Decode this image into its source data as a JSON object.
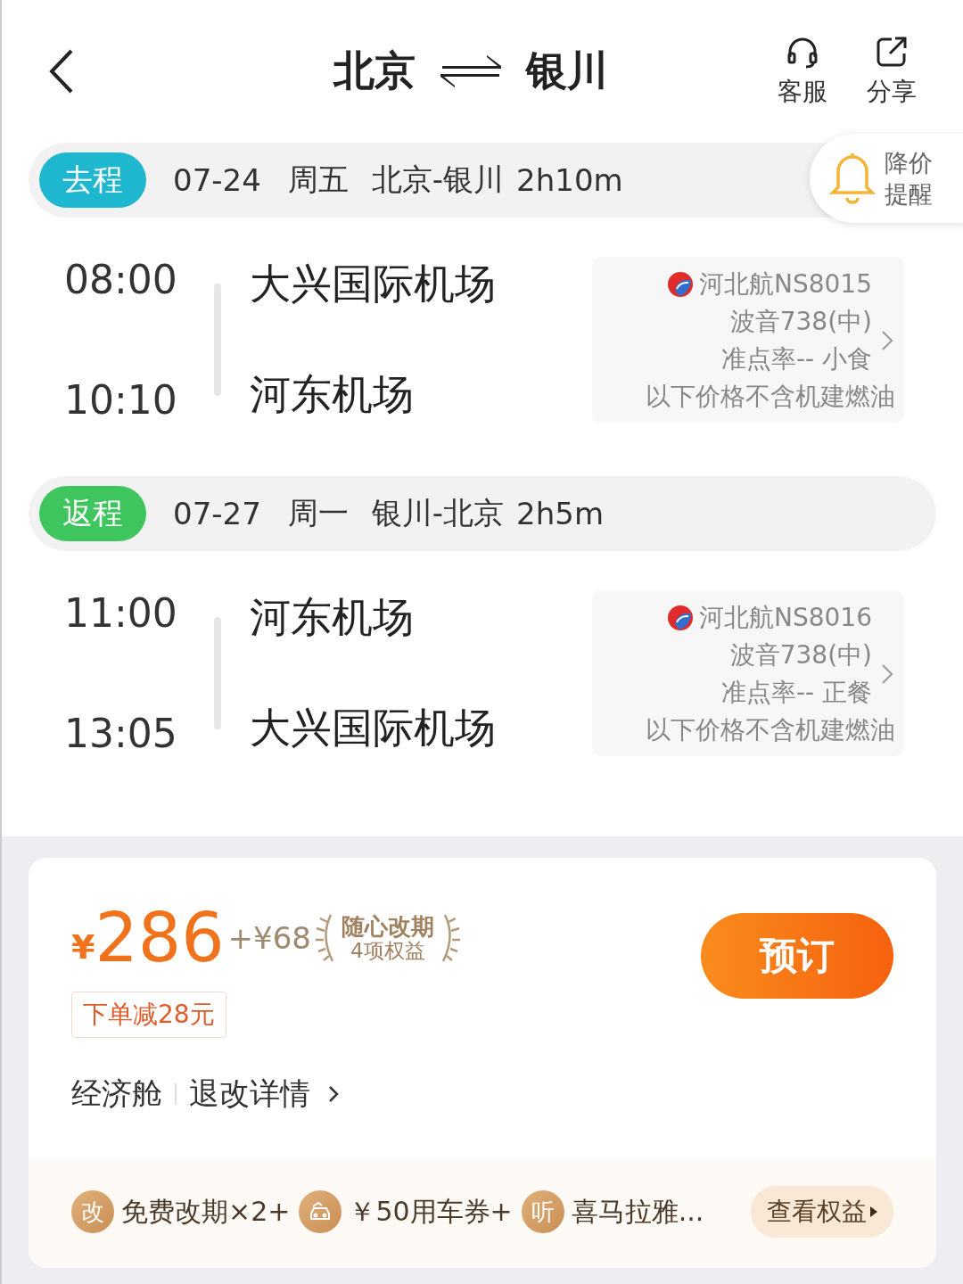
{
  "header": {
    "from": "北京",
    "to": "银川",
    "actions": [
      {
        "kind": "headset",
        "label": "客服"
      },
      {
        "kind": "share",
        "label": "分享"
      }
    ]
  },
  "price_alert": {
    "label": "降价提醒"
  },
  "legs": [
    {
      "tag": "去程",
      "color": "#1fb6cf",
      "date": "07-24",
      "weekday": "周五",
      "route": "北京-银川",
      "duration": "2h10m",
      "depart_time": "08:00",
      "depart_airport": "大兴国际机场",
      "arrive_time": "10:10",
      "arrive_airport": "河东机场",
      "flight": "河北航NS8015",
      "aircraft": "波音738(中)",
      "service": "准点率-- 小食",
      "note": "以下价格不含机建燃油"
    },
    {
      "tag": "返程",
      "color": "#3fc55e",
      "date": "07-27",
      "weekday": "周一",
      "route": "银川-北京",
      "duration": "2h5m",
      "depart_time": "11:00",
      "depart_airport": "河东机场",
      "arrive_time": "13:05",
      "arrive_airport": "大兴国际机场",
      "flight": "河北航NS8016",
      "aircraft": "波音738(中)",
      "service": "准点率-- 正餐",
      "note": "以下价格不含机建燃油"
    }
  ],
  "offer": {
    "currency": "¥",
    "amount": "286",
    "extra": "+¥68",
    "perk_title": "随心改期",
    "perk_subtitle": "4项权益",
    "discount": "下单减28元",
    "book": "预订",
    "cabin": "经济舱",
    "rules": "退改详情"
  },
  "benefits": [
    {
      "kind": "glyph",
      "glyph": "改",
      "label": "免费改期×2+"
    },
    {
      "kind": "car",
      "label": "￥50用车券+"
    },
    {
      "kind": "glyph",
      "glyph": "听",
      "label": "喜马拉雅..."
    }
  ],
  "benefits_link": "查看权益"
}
